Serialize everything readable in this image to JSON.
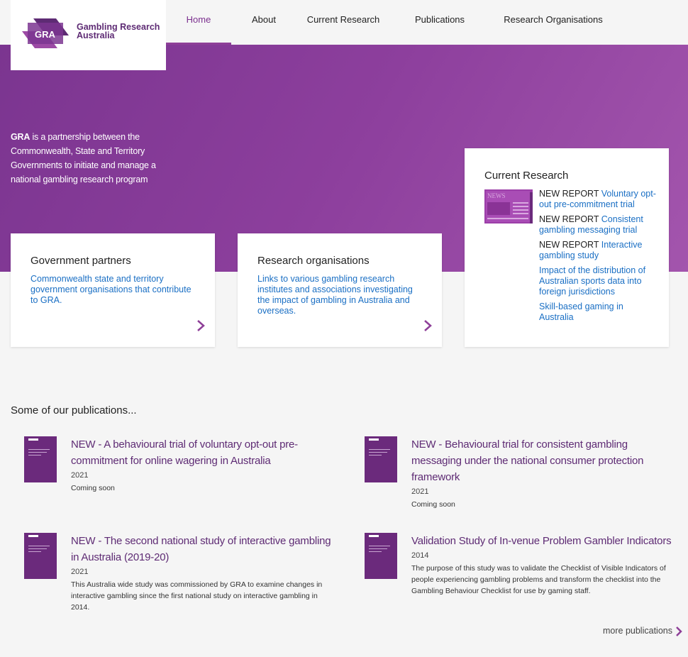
{
  "logo": {
    "mark_text": "GRA",
    "text_line1": "Gambling Research",
    "text_line2": "Australia"
  },
  "nav": [
    {
      "label": "Home",
      "active": true
    },
    {
      "label": "About"
    },
    {
      "label": "Current Research"
    },
    {
      "label": "Publications"
    },
    {
      "label": "Research Organisations"
    }
  ],
  "hero": {
    "lead": "GRA",
    "text": " is a partnership between the Commonwealth, State and Territory Governments to initiate and manage a national gambling research program"
  },
  "cards": {
    "government": {
      "title": "Government partners",
      "desc": "Commonwealth state and territory government organisations that contribute to GRA."
    },
    "research": {
      "title": "Research organisations",
      "desc": "Links to various gambling research institutes and associations investigating the impact of gambling in Australia and overseas."
    }
  },
  "current_research": {
    "title": "Current Research",
    "image_text": "NEWS",
    "items": [
      {
        "tag": "NEW REPORT",
        "text": "Voluntary opt-out pre-commitment trial"
      },
      {
        "tag": "NEW REPORT",
        "text": "Consistent gambling messaging trial"
      },
      {
        "tag": "NEW REPORT",
        "text": "Interactive gambling study"
      },
      {
        "tag": "",
        "text": "Impact of the distribution of Australian sports data into foreign jurisdictions"
      },
      {
        "tag": "",
        "text": "Skill-based gaming in Australia"
      }
    ]
  },
  "publications": {
    "heading": "Some of our publications...",
    "items": [
      {
        "title": "NEW - A behavioural trial of voluntary opt-out pre-commitment for online wagering in Australia",
        "year": "2021",
        "desc": "Coming soon"
      },
      {
        "title": "NEW - Behavioural trial for consistent gambling messaging under the national consumer protection framework",
        "year": "2021",
        "desc": "Coming soon"
      },
      {
        "title": "NEW - The second national study of interactive gambling in Australia (2019-20)",
        "year": "2021",
        "desc": "This Australia wide study was commissioned by GRA to examine changes in interactive gambling since the first national study on interactive gambling in 2014."
      },
      {
        "title": "Validation Study of In-venue Problem Gambler Indicators",
        "year": "2014",
        "desc": "The purpose of this study was to validate the Checklist of Visible Indicators of people experiencing gambling problems and transform the checklist into the Gambling Behaviour Checklist for use by gaming staff."
      }
    ],
    "more_label": "more publications"
  },
  "colors": {
    "brand_purple": "#7b2f8e",
    "link_blue": "#1a6fc4",
    "title_purple": "#5e2b74"
  }
}
